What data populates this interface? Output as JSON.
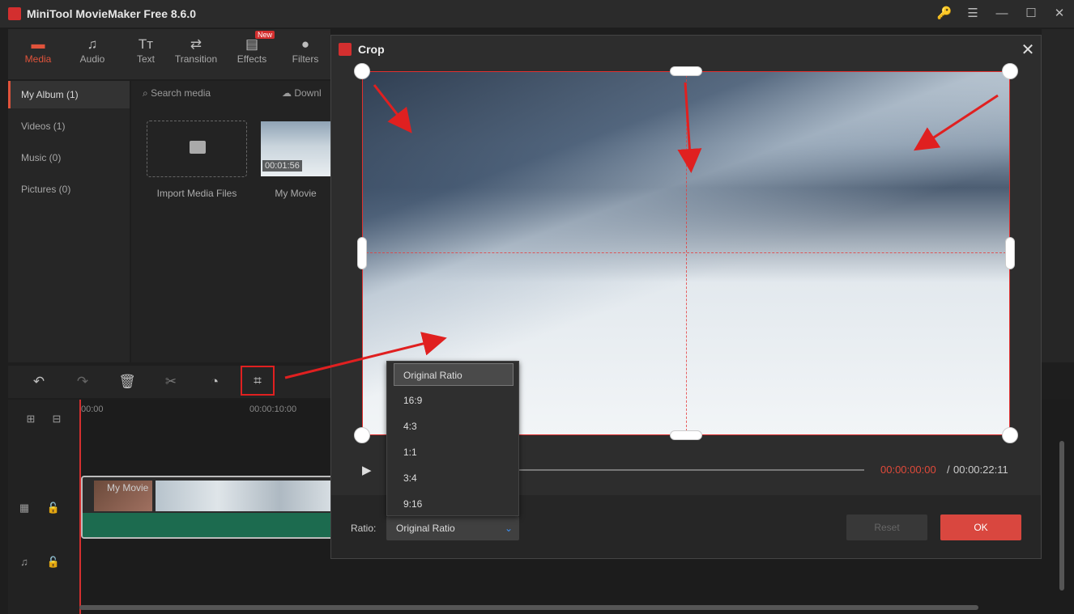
{
  "app": {
    "title": "MiniTool MovieMaker Free 8.6.0"
  },
  "window_controls": {
    "key": "🔑",
    "menu": "☰",
    "minimize": "—",
    "maximize": "☐",
    "close": "✕"
  },
  "toolbar": {
    "items": [
      {
        "label": "Media",
        "icon": "▬",
        "active": true
      },
      {
        "label": "Audio",
        "icon": "♫"
      },
      {
        "label": "Text",
        "icon": "Tт"
      },
      {
        "label": "Transition",
        "icon": "⇄"
      },
      {
        "label": "Effects",
        "icon": "▤",
        "badge": "New"
      },
      {
        "label": "Filters",
        "icon": "●"
      }
    ]
  },
  "sidebar": {
    "items": [
      {
        "label": "My Album (1)"
      },
      {
        "label": "Videos (1)"
      },
      {
        "label": "Music (0)"
      },
      {
        "label": "Pictures (0)"
      }
    ]
  },
  "media": {
    "search_placeholder": "Search media",
    "download_label": "Downl",
    "import_label": "Import Media Files",
    "clip_label": "My Movie",
    "clip_duration": "00:01:56"
  },
  "timeline": {
    "ruler": [
      "00:00",
      "00:00:10:00"
    ],
    "clip_name": "My Movie"
  },
  "dialog": {
    "title": "Crop",
    "time_current": "00:00:00:00",
    "time_sep": "/",
    "time_total": "00:00:22:11",
    "ratio_label": "Ratio:",
    "ratio_value": "Original Ratio",
    "reset_label": "Reset",
    "ok_label": "OK",
    "ratio_options": [
      "Original Ratio",
      "16:9",
      "4:3",
      "1:1",
      "3:4",
      "9:16"
    ]
  },
  "colors": {
    "accent": "#e0533b",
    "ok_button": "#d9473f",
    "crop_frame": "#e03030",
    "annotation": "#e02020"
  },
  "icons": [
    "app-logo-icon",
    "key-icon",
    "menu-icon",
    "minimize-icon",
    "maximize-icon",
    "close-icon",
    "undo-icon",
    "redo-icon",
    "delete-icon",
    "split-icon",
    "speed-icon",
    "crop-icon",
    "play-icon",
    "chevron-down-icon",
    "folder-icon",
    "film-icon",
    "lock-icon",
    "music-icon"
  ]
}
